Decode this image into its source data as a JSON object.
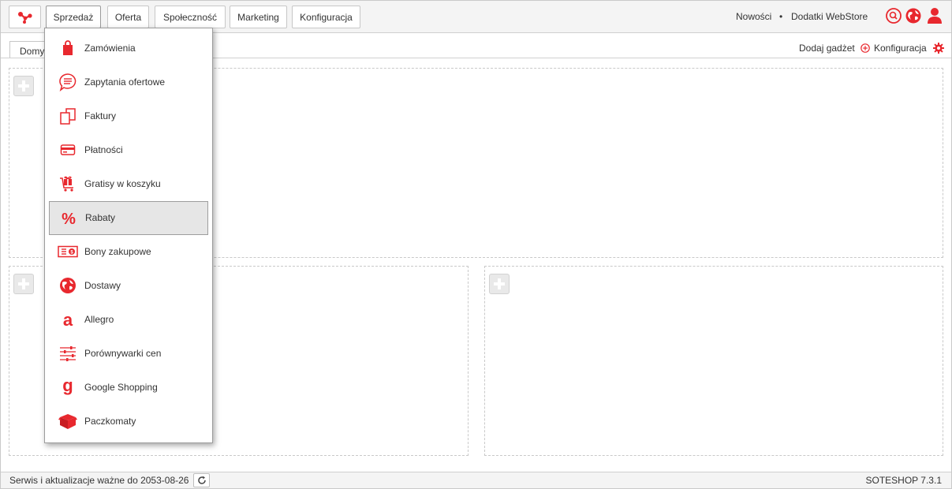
{
  "app": {
    "accent": "#e8282e"
  },
  "nav": {
    "logo_icon": "soteshop-logo-icon",
    "tabs": [
      "Sprzedaż",
      "Oferta",
      "Społeczność",
      "Marketing",
      "Konfiguracja"
    ],
    "active_tab": "Sprzedaż",
    "links": [
      "Nowości",
      "Dodatki WebStore"
    ],
    "separator": "•",
    "icons": [
      "search-icon",
      "globe-icon",
      "user-icon"
    ]
  },
  "subbar": {
    "tab_label": "Domy",
    "add_gadget": "Dodaj gadżet",
    "config": "Konfiguracja"
  },
  "dropdown": {
    "selected": "Rabaty",
    "items": [
      {
        "label": "Zamówienia",
        "icon": "shopping-bag-icon"
      },
      {
        "label": "Zapytania ofertowe",
        "icon": "chat-bubble-icon"
      },
      {
        "label": "Faktury",
        "icon": "documents-icon"
      },
      {
        "label": "Płatności",
        "icon": "credit-card-icon"
      },
      {
        "label": "Gratisy w koszyku",
        "icon": "gift-cart-icon"
      },
      {
        "label": "Rabaty",
        "icon": "percent-icon"
      },
      {
        "label": "Bony zakupowe",
        "icon": "voucher-icon"
      },
      {
        "label": "Dostawy",
        "icon": "globe-delivery-icon"
      },
      {
        "label": "Allegro",
        "icon": "allegro-icon"
      },
      {
        "label": "Porównywarki cen",
        "icon": "sliders-icon"
      },
      {
        "label": "Google Shopping",
        "icon": "google-g-icon"
      },
      {
        "label": "Paczkomaty",
        "icon": "parcel-locker-icon"
      }
    ]
  },
  "footer": {
    "service_text": "Serwis i aktualizacje ważne do 2053-08-26",
    "version": "SOTESHOP 7.3.1"
  }
}
